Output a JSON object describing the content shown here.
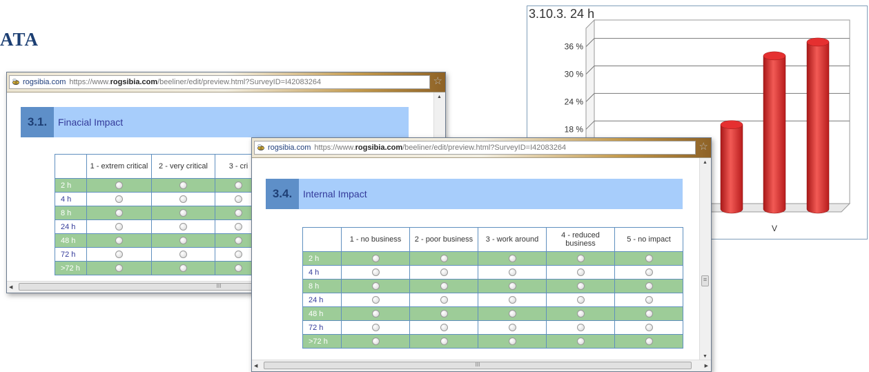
{
  "page": {
    "heading_fragment": "ATA"
  },
  "chart": {
    "title": "3.10.3. 24 h",
    "chart_data": {
      "type": "bar",
      "title": "3.10.3. 24 h",
      "y_ticks": [
        "18 %",
        "24 %",
        "30 %",
        "36 %"
      ],
      "x_tick_labels": [
        "V"
      ],
      "ylim": [
        0,
        40
      ],
      "grid": true,
      "values": [
        34,
        37
      ],
      "partial_bar_value": 19,
      "bar_color": "#e53030"
    }
  },
  "window1": {
    "site": "rogsibia.com",
    "url_prefix": "https://www.",
    "url_domain": "rogsibia.com",
    "url_suffix": "/beeliner/edit/preview.html?SurveyID=I42083264",
    "section_number": "3.1.",
    "section_title": "Finacial Impact",
    "columns": [
      "1 - extrem critical",
      "2 - very critical",
      "3 - cri"
    ],
    "rows": [
      "2 h",
      "4 h",
      "8 h",
      "24 h",
      "48 h",
      "72 h",
      ">72 h"
    ],
    "scroll_mark": "III"
  },
  "window2": {
    "site": "rogsibia.com",
    "url_prefix": "https://www.",
    "url_domain": "rogsibia.com",
    "url_suffix": "/beeliner/edit/preview.html?SurveyID=I42083264",
    "section_number": "3.4.",
    "section_title": "Internal Impact",
    "columns": [
      "1 - no business",
      "2 - poor business",
      "3 - work around",
      "4 - reduced business",
      "5 - no impact"
    ],
    "rows": [
      "2 h",
      "4 h",
      "8 h",
      "24 h",
      "48 h",
      "72 h",
      ">72 h"
    ],
    "scroll_mark": "III"
  },
  "colors": {
    "accent": "#5e8fc8",
    "header_band": "#a7cdfb",
    "row_green": "#9dcc98",
    "heading": "#1c3f73",
    "bar": "#e53030"
  }
}
